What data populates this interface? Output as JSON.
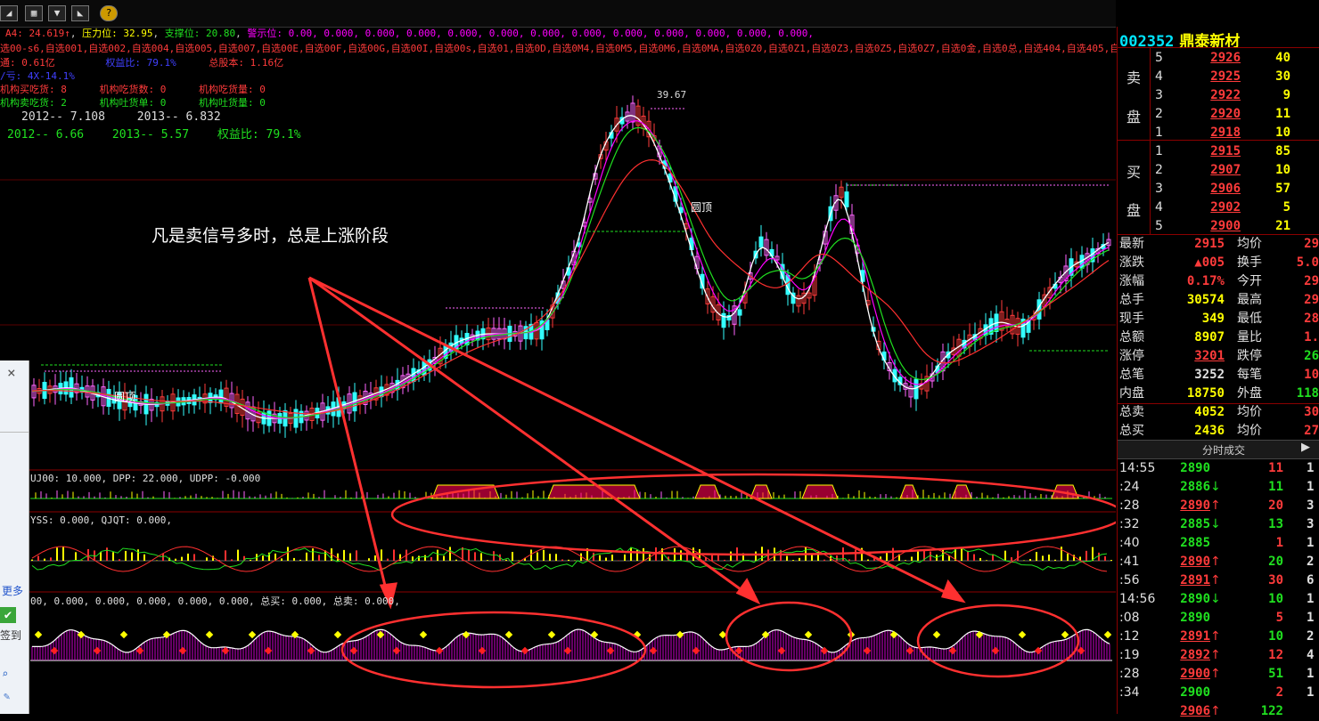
{
  "toolbar": {
    "icons": [
      "chart-icon",
      "calendar-icon",
      "download-icon",
      "graph-icon",
      "help-icon"
    ]
  },
  "indicator_line": {
    "a4": "A4: 24.619↑",
    "pressure": "压力位: 32.95",
    "support": "支撑位: 20.80",
    "warn": "警示位: 0.00,",
    "zeros": "0.000, 0.000, 0.000, 0.000, 0.000, 0.000, 0.000, 0.000, 0.000, 0.000, 0.000, 0.000,"
  },
  "watch_line": "选00-s6,自选001,自选002,自选004,自选005,自选007,自选00E,自选00F,自选00G,自选00I,自选00s,自选01,自选0D,自选0M4,自选0M5,自选0M6,自选0MA,自选0Z0,自选0Z1,自选0Z3,自选0Z5,自选0Z7,自选0金,自选0总,自选404,自选405,自选",
  "fund_info": {
    "circulation": "通: 0.61亿",
    "equity_ratio": "权益比: 79.1%",
    "total_capital": "总股本: 1.16亿",
    "ratio_line": "/亏: 4X-14.1%",
    "inst_buy_eat": "机构买吃货: 8",
    "inst_eat_amt": "机构吃货数: 0",
    "inst_eat_vol": "机构吃货量: 0",
    "inst_sell_eat": "机构卖吃货: 2",
    "inst_spit_single": "机构吐货单: 0",
    "inst_spit_vol": "机构吐货量: 0",
    "eps_2012": "2012-- 7.108",
    "eps_2013": "2013-- 6.832",
    "nav_2012": "2012-- 6.66",
    "nav_2013": "2013-- 5.57",
    "equity_ratio2": "权益比: 79.1%"
  },
  "chart_labels": {
    "peak": "39.67",
    "round_top_1": "圆顶",
    "round_top_2": "圆顶",
    "annotation": "凡是卖信号多时，总是上涨阶段"
  },
  "sub1_label": "UJ00: 10.000, DPP: 22.000, UDPP: -0.000",
  "sub2_label": "YSS: 0.000, QJQT: 0.000,",
  "sub3_label": "00, 0.000, 0.000, 0.000, 0.000, 0.000, 总买: 0.000, 总卖: 0.000,",
  "stock": {
    "code": "002352",
    "name": "鼎泰新材"
  },
  "order_book": {
    "sell_label_1": "卖",
    "sell_label_2": "盘",
    "buy_label_1": "买",
    "buy_label_2": "盘",
    "sell": [
      {
        "level": "5",
        "price": "2926",
        "vol": "40"
      },
      {
        "level": "4",
        "price": "2925",
        "vol": "30"
      },
      {
        "level": "3",
        "price": "2922",
        "vol": "9"
      },
      {
        "level": "2",
        "price": "2920",
        "vol": "11"
      },
      {
        "level": "1",
        "price": "2918",
        "vol": "10"
      }
    ],
    "buy": [
      {
        "level": "1",
        "price": "2915",
        "vol": "85"
      },
      {
        "level": "2",
        "price": "2907",
        "vol": "10"
      },
      {
        "level": "3",
        "price": "2906",
        "vol": "57"
      },
      {
        "level": "4",
        "price": "2902",
        "vol": "5"
      },
      {
        "level": "5",
        "price": "2900",
        "vol": "21"
      }
    ]
  },
  "quote": [
    {
      "l1": "最新",
      "v1": "2915",
      "l2": "均价",
      "v2": "29"
    },
    {
      "l1": "涨跌",
      "v1": "▲005",
      "l2": "换手",
      "v2": "5.0"
    },
    {
      "l1": "涨幅",
      "v1": "0.17%",
      "l2": "今开",
      "v2": "29"
    },
    {
      "l1": "总手",
      "v1": "30574",
      "l2": "最高",
      "v2": "29"
    },
    {
      "l1": "现手",
      "v1": "349",
      "l2": "最低",
      "v2": "28"
    },
    {
      "l1": "总额",
      "v1": "8907",
      "l2": "量比",
      "v2": "1."
    },
    {
      "l1": "涨停",
      "v1": "3201",
      "l2": "跌停",
      "v2": "26"
    },
    {
      "l1": "总笔",
      "v1": "3252",
      "l2": "每笔",
      "v2": "10"
    },
    {
      "l1": "内盘",
      "v1": "18750",
      "l2": "外盘",
      "v2": "118"
    },
    {
      "l1": "总卖",
      "v1": "4052",
      "l2": "均价",
      "v2": "30"
    },
    {
      "l1": "总买",
      "v1": "2436",
      "l2": "均价",
      "v2": "27"
    }
  ],
  "ticks_header": "分时成交",
  "ticks": [
    {
      "time": "14:55",
      "price": "2890",
      "arrow": "",
      "vol": "11",
      "extra": "1"
    },
    {
      "time": ":24",
      "price": "2886",
      "arrow": "↓",
      "vol": "11",
      "extra": "1"
    },
    {
      "time": ":28",
      "price": "2890",
      "arrow": "↑",
      "vol": "20",
      "extra": "3"
    },
    {
      "time": ":32",
      "price": "2885",
      "arrow": "↓",
      "vol": "13",
      "extra": "3"
    },
    {
      "time": ":40",
      "price": "2885",
      "arrow": "",
      "vol": "1",
      "extra": "1"
    },
    {
      "time": ":41",
      "price": "2890",
      "arrow": "↑",
      "vol": "20",
      "extra": "2"
    },
    {
      "time": ":56",
      "price": "2891",
      "arrow": "↑",
      "vol": "30",
      "extra": "6"
    },
    {
      "time": "14:56",
      "price": "2890",
      "arrow": "↓",
      "vol": "10",
      "extra": "1"
    },
    {
      "time": ":08",
      "price": "2890",
      "arrow": "",
      "vol": "5",
      "extra": "1"
    },
    {
      "time": ":12",
      "price": "2891",
      "arrow": "↑",
      "vol": "10",
      "extra": "2"
    },
    {
      "time": ":19",
      "price": "2892",
      "arrow": "↑",
      "vol": "12",
      "extra": "4"
    },
    {
      "time": ":28",
      "price": "2900",
      "arrow": "↑",
      "vol": "51",
      "extra": "1"
    },
    {
      "time": ":34",
      "price": "2900",
      "arrow": "",
      "vol": "2",
      "extra": "1"
    },
    {
      "time": "",
      "price": "2906",
      "arrow": "↑",
      "vol": "122",
      "extra": ""
    }
  ],
  "float_panel": {
    "close": "×",
    "more": "更多",
    "sign": "签到"
  },
  "colors": {
    "up": "#ff3b3b",
    "down": "#20e020",
    "yellow": "#ffff00",
    "magenta": "#ff00ff",
    "cyan": "#00ffff"
  }
}
